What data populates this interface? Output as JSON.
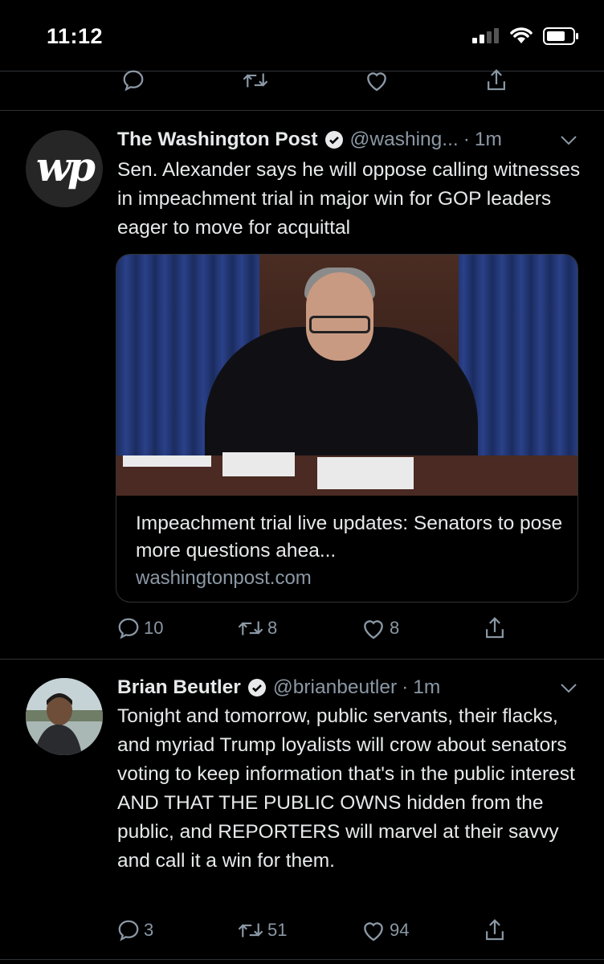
{
  "status_bar": {
    "time": "11:12"
  },
  "tweets": [
    {
      "name": "The Washington Post",
      "handle": "@washing...",
      "time": "1m",
      "text": "Sen. Alexander says he will oppose calling witnesses in impeachment trial in major win for GOP leaders eager to move for acquittal",
      "avatar_logo": "wp",
      "card": {
        "title": "Impeachment trial live updates: Senators to pose more questions ahea...",
        "domain": "washingtonpost.com"
      },
      "replies": "10",
      "retweets": "8",
      "likes": "8"
    },
    {
      "name": "Brian Beutler",
      "handle": "@brianbeutler",
      "time": "1m",
      "text": "Tonight and tomorrow, public servants, their flacks, and myriad Trump loyalists will crow about senators voting to keep information that's in the public interest AND THAT THE PUBLIC OWNS hidden from the public, and REPORTERS will marvel at their savvy and call it a win for them.",
      "replies": "3",
      "retweets": "51",
      "likes": "94"
    }
  ],
  "colors": {
    "background": "#000000",
    "muted": "#8b98a5",
    "divider": "#2f3336",
    "text": "#e7e9ea"
  },
  "icons": [
    "reply-icon",
    "retweet-icon",
    "like-icon",
    "share-icon",
    "verified-icon",
    "chevron-down-icon",
    "signal-icon",
    "wifi-icon",
    "battery-icon"
  ]
}
